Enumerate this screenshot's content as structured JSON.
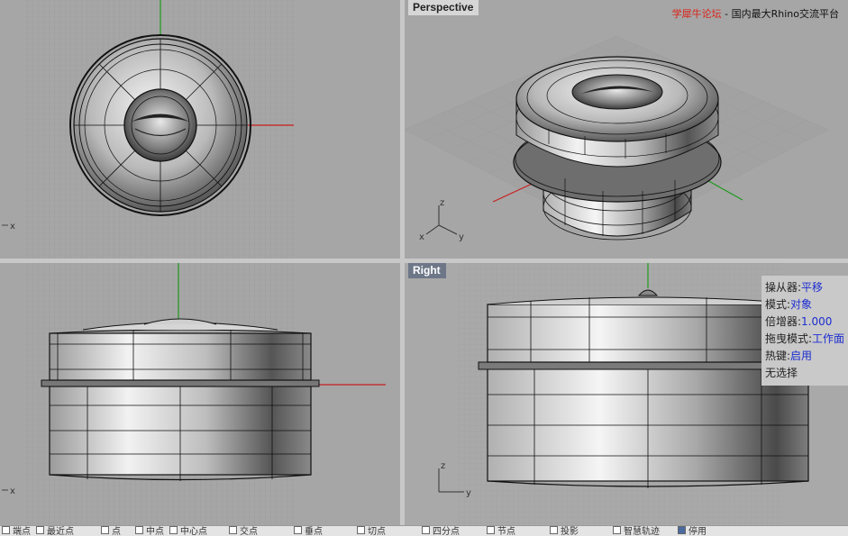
{
  "viewports": {
    "top": {
      "axis_label": "x"
    },
    "perspective": {
      "title": "Perspective",
      "axis_labels": {
        "z": "z",
        "x": "x",
        "y": "y"
      },
      "watermark": {
        "red": "学犀牛论坛",
        "sep": "-",
        "rest": "国内最大Rhino交流平台"
      }
    },
    "front": {
      "axis_label": "x"
    },
    "right": {
      "title": "Right",
      "axis_labels": {
        "z": "z",
        "y": "y"
      }
    }
  },
  "gumball_panel": {
    "rows": [
      {
        "label": "操从器:",
        "value": "平移"
      },
      {
        "label": "模式:",
        "value": "对象"
      },
      {
        "label": "倍增器:",
        "value": "1.000"
      },
      {
        "label": "拖曳模式:",
        "value": "工作面"
      },
      {
        "label": "热键:",
        "value": "启用"
      }
    ],
    "selection": "无选择"
  },
  "statusbar": {
    "osnaps": [
      {
        "label": "端点",
        "checked": false
      },
      {
        "label": "最近点",
        "checked": false
      },
      {
        "label": "点",
        "checked": false
      },
      {
        "label": "中点",
        "checked": false
      },
      {
        "label": "中心点",
        "checked": false
      },
      {
        "label": "交点",
        "checked": false
      },
      {
        "label": "垂点",
        "checked": false
      },
      {
        "label": "切点",
        "checked": false
      },
      {
        "label": "四分点",
        "checked": false
      },
      {
        "label": "节点",
        "checked": false
      },
      {
        "label": "投影",
        "checked": false
      },
      {
        "label": "智慧轨迹",
        "checked": false
      },
      {
        "label": "停用",
        "checked": true
      }
    ]
  },
  "colors": {
    "viewport_bg": "#a6a6a6",
    "active_title": "#6d7788",
    "axis_x": "#c81e1e",
    "axis_y": "#1e9a1e",
    "watermark_red": "#d9231a"
  }
}
